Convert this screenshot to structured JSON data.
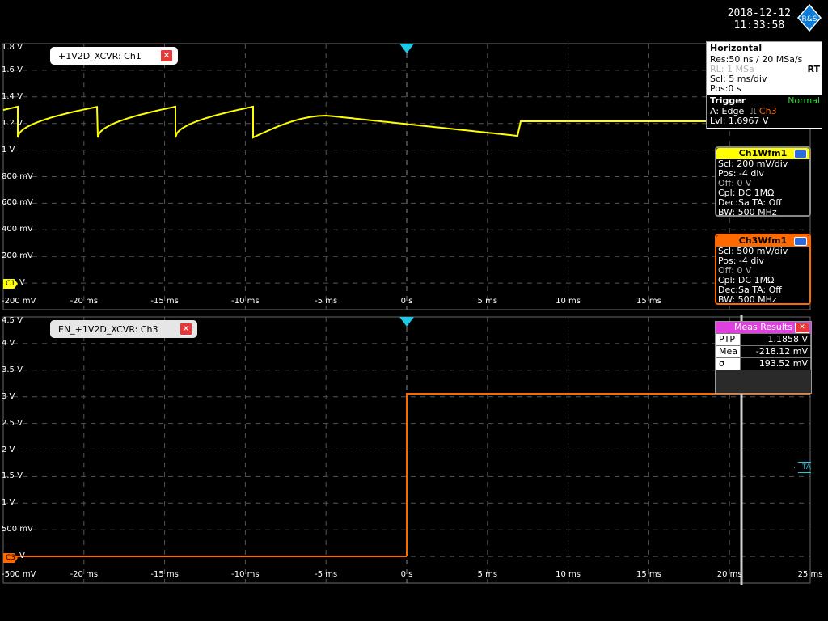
{
  "datetime": {
    "date": "2018-12-12",
    "time": "11:33:58"
  },
  "logo": {
    "text": "R&S"
  },
  "colors": {
    "ch1": "#ffff00",
    "ch3": "#ff6a00",
    "meas": "#e040e0",
    "grid": "#6a6a6a"
  },
  "upper_diagram": {
    "title": "+1V2D_XCVR: Ch1",
    "y_labels": [
      "1.8 V",
      "1.6 V",
      "1.4 V",
      "1.2 V",
      "1 V",
      "800 mV",
      "600 mV",
      "400 mV",
      "200 mV",
      "V",
      "-200 mV"
    ],
    "ground_marker": "C1",
    "x_labels": [
      "-20 ms",
      "-15 ms",
      "-10 ms",
      "-5 ms",
      "0 s",
      "5 ms",
      "10 ms",
      "15 ms"
    ]
  },
  "lower_diagram": {
    "title": "EN_+1V2D_XCVR: Ch3",
    "y_labels": [
      "4.5 V",
      "4 V",
      "3.5 V",
      "3 V",
      "2.5 V",
      "2 V",
      "1.5 V",
      "1 V",
      "500 mV",
      "V",
      "-500 mV"
    ],
    "ground_marker": "C3",
    "x_labels": [
      "-20 ms",
      "-15 ms",
      "-10 ms",
      "-5 ms",
      "0 s",
      "5 ms",
      "10 ms",
      "15 ms",
      "20 ms",
      "25 ms"
    ],
    "trigger_level_marker": "TA"
  },
  "horizontal": {
    "title": "Horizontal",
    "res": "Res:50 ns / 20 MSa/s",
    "rl": "RL: 1 MSa",
    "rt": "RT",
    "scl": "Scl: 5 ms/div",
    "pos": "Pos:0 s"
  },
  "trigger": {
    "title": "Trigger",
    "mode": "Normal",
    "a": "A:  Edge",
    "source": "Ch3",
    "lvl": "Lvl: 1.6967 V"
  },
  "ch1_panel": {
    "title": "Ch1Wfm1",
    "rows": [
      "Scl: 200 mV/div",
      "Pos: -4 div",
      "Off: 0 V",
      "Cpl: DC 1MΩ",
      "Dec:Sa    TA: Off",
      "BW: 500 MHz"
    ]
  },
  "ch3_panel": {
    "title": "Ch3Wfm1",
    "rows": [
      "Scl: 500 mV/div",
      "Pos: -4 div",
      "Off: 0 V",
      "Cpl: DC 1MΩ",
      "Dec:Sa    TA: Off",
      "BW: 500 MHz"
    ]
  },
  "meas_results": {
    "title": "Meas Results",
    "rows": [
      {
        "label": "PTP",
        "value": "1.1858 V"
      },
      {
        "label": "Mea",
        "value": "-218.12 mV"
      },
      {
        "label": "σ",
        "value": "193.52 mV"
      }
    ]
  }
}
